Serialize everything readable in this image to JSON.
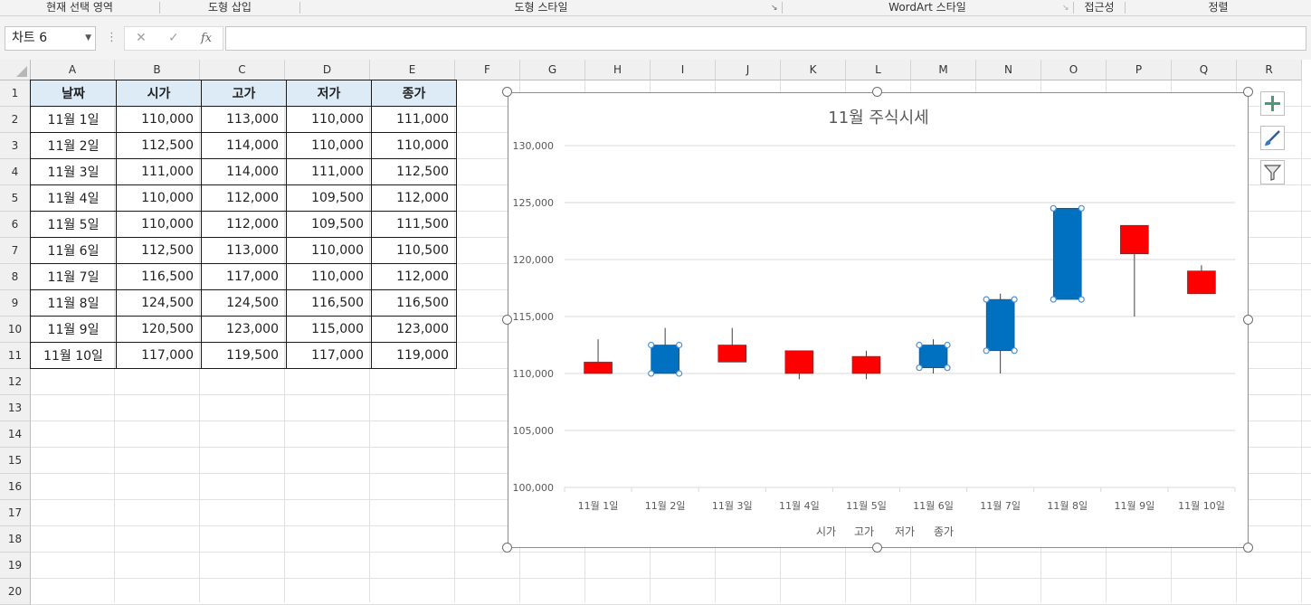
{
  "ribbon": {
    "groups": [
      "현재 선택 영역",
      "도형 삽입",
      "도형 스타일",
      "WordArt 스타일",
      "접근성",
      "정렬"
    ]
  },
  "formula_bar": {
    "name_box": "차트 6",
    "cancel_icon": "✕",
    "enter_icon": "✓",
    "fx_label": "fx",
    "formula": ""
  },
  "columns": [
    "A",
    "B",
    "C",
    "D",
    "E",
    "F",
    "G",
    "H",
    "I",
    "J",
    "K",
    "L",
    "M",
    "N",
    "O",
    "P",
    "Q",
    "R"
  ],
  "rows": [
    "1",
    "2",
    "3",
    "4",
    "5",
    "6",
    "7",
    "8",
    "9",
    "10",
    "11",
    "12",
    "13",
    "14",
    "15",
    "16",
    "17",
    "18",
    "19",
    "20"
  ],
  "table": {
    "headers": [
      "날짜",
      "시가",
      "고가",
      "저가",
      "종가"
    ],
    "rows": [
      [
        "11월 1일",
        "110,000",
        "113,000",
        "110,000",
        "111,000"
      ],
      [
        "11월 2일",
        "112,500",
        "114,000",
        "110,000",
        "110,000"
      ],
      [
        "11월 3일",
        "111,000",
        "114,000",
        "111,000",
        "112,500"
      ],
      [
        "11월 4일",
        "110,000",
        "112,000",
        "109,500",
        "112,000"
      ],
      [
        "11월 5일",
        "110,000",
        "112,000",
        "109,500",
        "111,500"
      ],
      [
        "11월 6일",
        "112,500",
        "113,000",
        "110,000",
        "110,500"
      ],
      [
        "11월 7일",
        "116,500",
        "117,000",
        "110,000",
        "112,000"
      ],
      [
        "11월 8일",
        "124,500",
        "124,500",
        "116,500",
        "116,500"
      ],
      [
        "11월 9일",
        "120,500",
        "123,000",
        "115,000",
        "123,000"
      ],
      [
        "11월 10일",
        "117,000",
        "119,500",
        "117,000",
        "119,000"
      ]
    ]
  },
  "chart_data": {
    "type": "candlestick",
    "title": "11월 주식시세",
    "categories": [
      "11월 1일",
      "11월 2일",
      "11월 3일",
      "11월 4일",
      "11월 5일",
      "11월 6일",
      "11월 7일",
      "11월 8일",
      "11월 9일",
      "11월 10일"
    ],
    "series": [
      {
        "name": "시가",
        "values": [
          110000,
          112500,
          111000,
          110000,
          110000,
          112500,
          116500,
          124500,
          120500,
          117000
        ]
      },
      {
        "name": "고가",
        "values": [
          113000,
          114000,
          114000,
          112000,
          112000,
          113000,
          117000,
          124500,
          123000,
          119500
        ]
      },
      {
        "name": "저가",
        "values": [
          110000,
          110000,
          111000,
          109500,
          109500,
          110000,
          110000,
          116500,
          115000,
          117000
        ]
      },
      {
        "name": "종가",
        "values": [
          111000,
          110000,
          112500,
          112000,
          111500,
          110500,
          112000,
          116500,
          123000,
          119000
        ]
      }
    ],
    "ylim": [
      100000,
      130000
    ],
    "yticks": [
      100000,
      105000,
      110000,
      115000,
      120000,
      125000,
      130000
    ],
    "ytick_labels": [
      "100,000",
      "105,000",
      "110,000",
      "115,000",
      "120,000",
      "125,000",
      "130,000"
    ],
    "grid": true,
    "legend_position": "bottom",
    "colors": {
      "up": "#ff0000",
      "down": "#0070c0",
      "wick": "#404040",
      "grid": "#d9d9d9"
    }
  },
  "chart_buttons": [
    "plus-icon",
    "brush-icon",
    "filter-icon"
  ]
}
